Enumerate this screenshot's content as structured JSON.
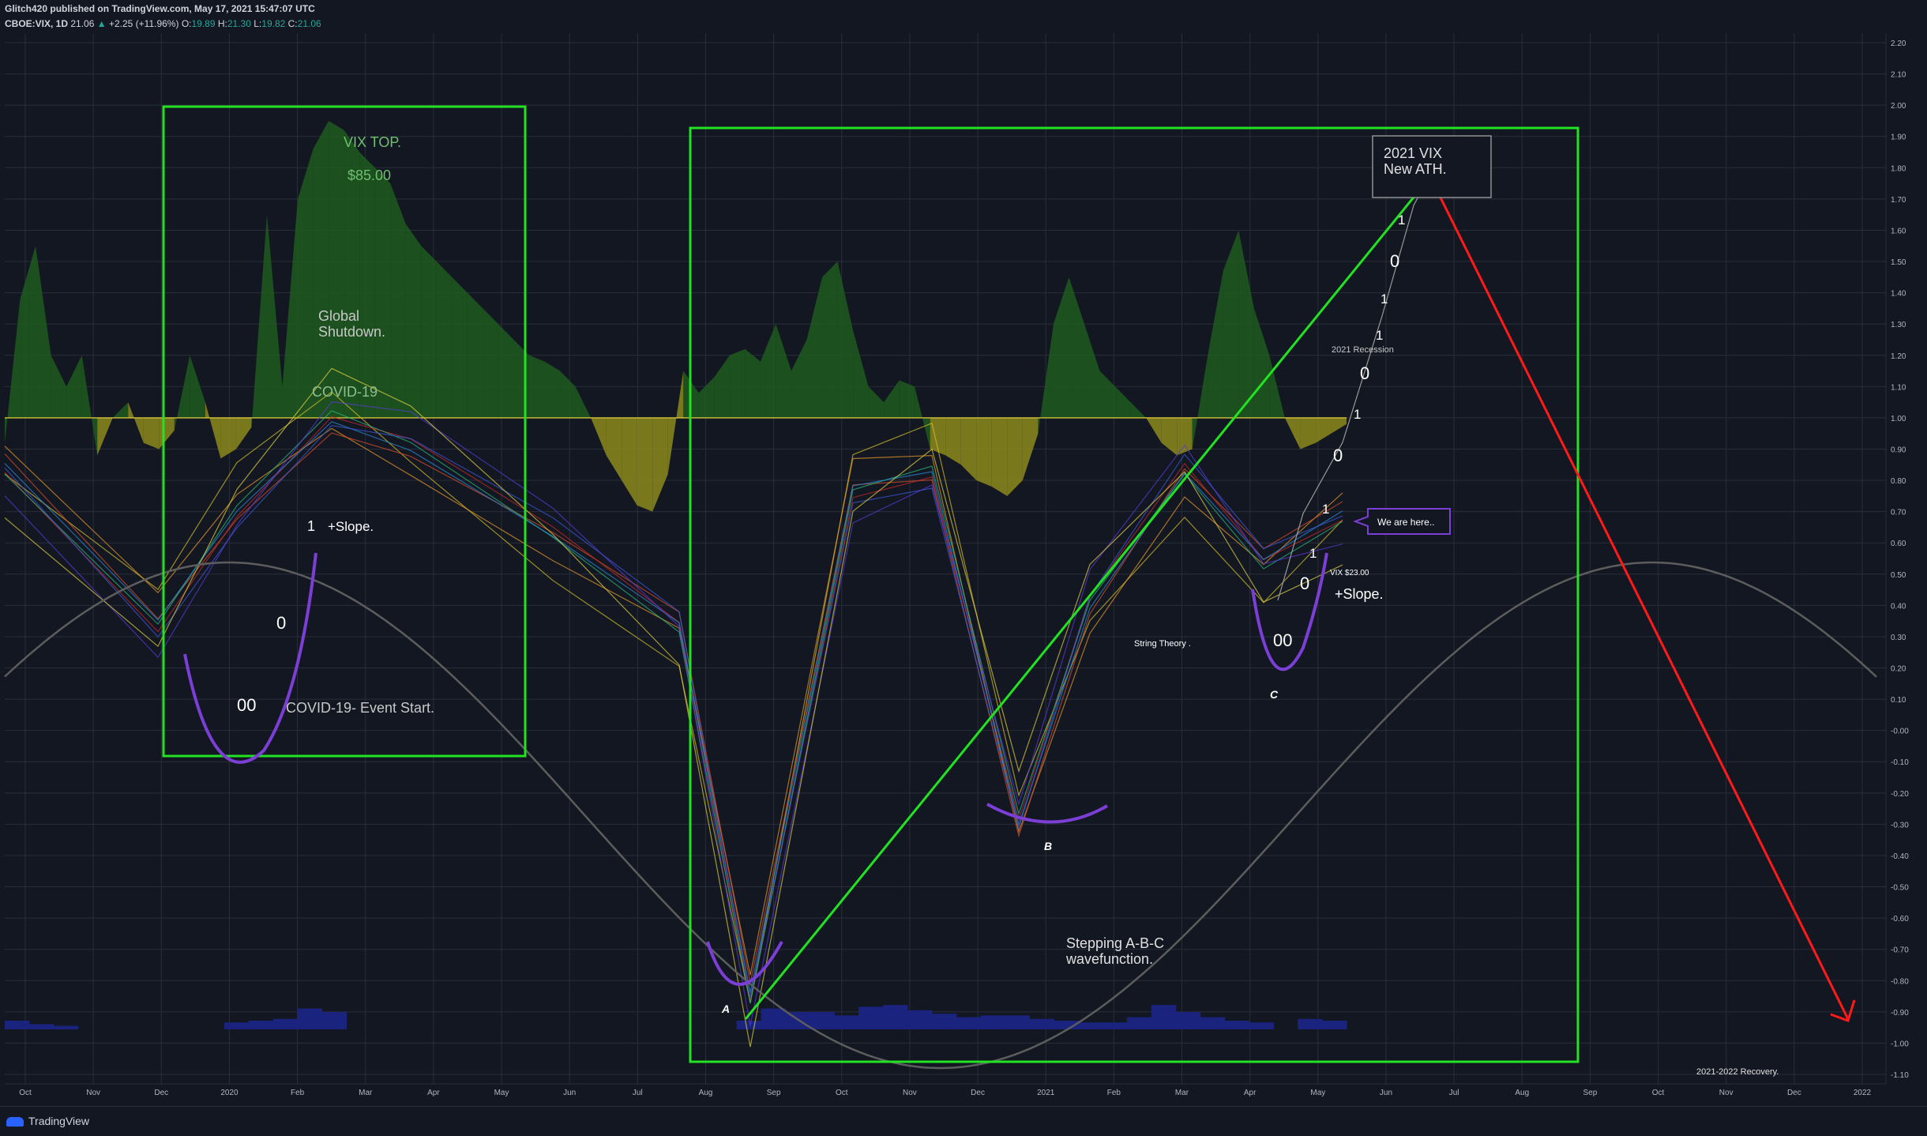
{
  "header": {
    "publisher": "Glitch420 published on TradingView.com, May 17, 2021 15:47:07 UTC",
    "symbol": "CBOE:VIX, 1D",
    "last": "21.06",
    "change": "+2.25 (+11.96%)",
    "o_label": "O:",
    "o": "19.89",
    "h_label": "H:",
    "h": "21.30",
    "l_label": "L:",
    "l": "19.82",
    "c_label": "C:",
    "c": "21.06"
  },
  "footer": {
    "brand": "TradingView"
  },
  "colors": {
    "background": "#131722",
    "grid": "#2a2e39",
    "box": "#22e222",
    "arrow": "#ff1a1a",
    "wave": "#5d5d5d",
    "cup": "#7b3fd6",
    "positive_area": "#1f5a1f",
    "negative_area": "#8d8a1c",
    "volume": "#1a237e"
  },
  "chart_data": {
    "type": "area",
    "title": "",
    "xlabel": "",
    "ylabel": "",
    "ylim": [
      -1.1,
      2.2
    ],
    "y_ticks": [
      "2.20",
      "2.10",
      "2.00",
      "1.90",
      "1.80",
      "1.70",
      "1.60",
      "1.50",
      "1.40",
      "1.30",
      "1.20",
      "1.10",
      "1.00",
      "0.90",
      "0.80",
      "0.70",
      "0.60",
      "0.50",
      "0.40",
      "0.30",
      "0.20",
      "0.10",
      "-0.00",
      "-0.10",
      "-0.20",
      "-0.30",
      "-0.40",
      "-0.50",
      "-0.60",
      "-0.70",
      "-0.80",
      "-0.90",
      "-1.00",
      "-1.10"
    ],
    "x_ticks": [
      "Oct",
      "Nov",
      "Dec",
      "2020",
      "Feb",
      "Mar",
      "Apr",
      "May",
      "Jun",
      "Jul",
      "Aug",
      "Sep",
      "Oct",
      "Nov",
      "Dec",
      "2021",
      "Feb",
      "Mar",
      "Apr",
      "May",
      "Jun",
      "Jul",
      "Aug",
      "Sep",
      "Oct",
      "Nov",
      "Dec",
      "2022"
    ],
    "oscillator": {
      "baseline": 1.0,
      "values": [
        0.92,
        1.38,
        1.55,
        1.2,
        1.1,
        1.2,
        0.88,
        1.0,
        1.05,
        0.92,
        0.9,
        0.96,
        1.2,
        1.05,
        0.87,
        0.9,
        0.97,
        1.65,
        1.1,
        1.7,
        1.86,
        1.95,
        1.92,
        1.85,
        1.8,
        1.75,
        1.62,
        1.55,
        1.5,
        1.45,
        1.4,
        1.35,
        1.3,
        1.25,
        1.2,
        1.18,
        1.15,
        1.1,
        1.0,
        0.88,
        0.8,
        0.72,
        0.7,
        0.82,
        1.15,
        1.08,
        1.13,
        1.2,
        1.22,
        1.18,
        1.3,
        1.15,
        1.25,
        1.45,
        1.5,
        1.28,
        1.1,
        1.05,
        1.12,
        1.1,
        0.9,
        0.88,
        0.85,
        0.8,
        0.78,
        0.75,
        0.8,
        0.95,
        1.3,
        1.45,
        1.3,
        1.15,
        1.1,
        1.05,
        1.0,
        0.92,
        0.88,
        0.9,
        1.2,
        1.47,
        1.6,
        1.35,
        1.2,
        1.0,
        0.9,
        0.92,
        0.95,
        0.98
      ]
    },
    "volume": [
      0.05,
      0.03,
      0.02,
      0,
      0,
      0,
      0,
      0,
      0,
      0.04,
      0.05,
      0.06,
      0.12,
      0.1,
      0,
      0,
      0,
      0,
      0,
      0,
      0,
      0,
      0,
      0,
      0,
      0,
      0,
      0,
      0,
      0,
      0.05,
      0.12,
      0.1,
      0.1,
      0.08,
      0.13,
      0.14,
      0.11,
      0.09,
      0.07,
      0.08,
      0.08,
      0.06,
      0.05,
      0.04,
      0.04,
      0.07,
      0.14,
      0.1,
      0.07,
      0.05,
      0.04,
      0,
      0.06,
      0.05
    ],
    "annotations": [
      "VIX TOP.",
      "$85.00",
      "Global",
      "Shutdown.",
      "COVID-19",
      "1",
      "+Slope.",
      "0",
      "00",
      "COVID-19- Event Start.",
      "2021 VIX",
      "New ATH.",
      "1",
      "0",
      "1",
      "1",
      "2021 Recession",
      "0",
      "1",
      "0",
      "1",
      "We are here..",
      "1",
      "VIX $23.00",
      "0",
      "+Slope.",
      "00",
      "C",
      "String Theory .",
      "B",
      "A",
      "Stepping A-B-C",
      "wavefunction.",
      "2021-2022 Recovery."
    ]
  }
}
